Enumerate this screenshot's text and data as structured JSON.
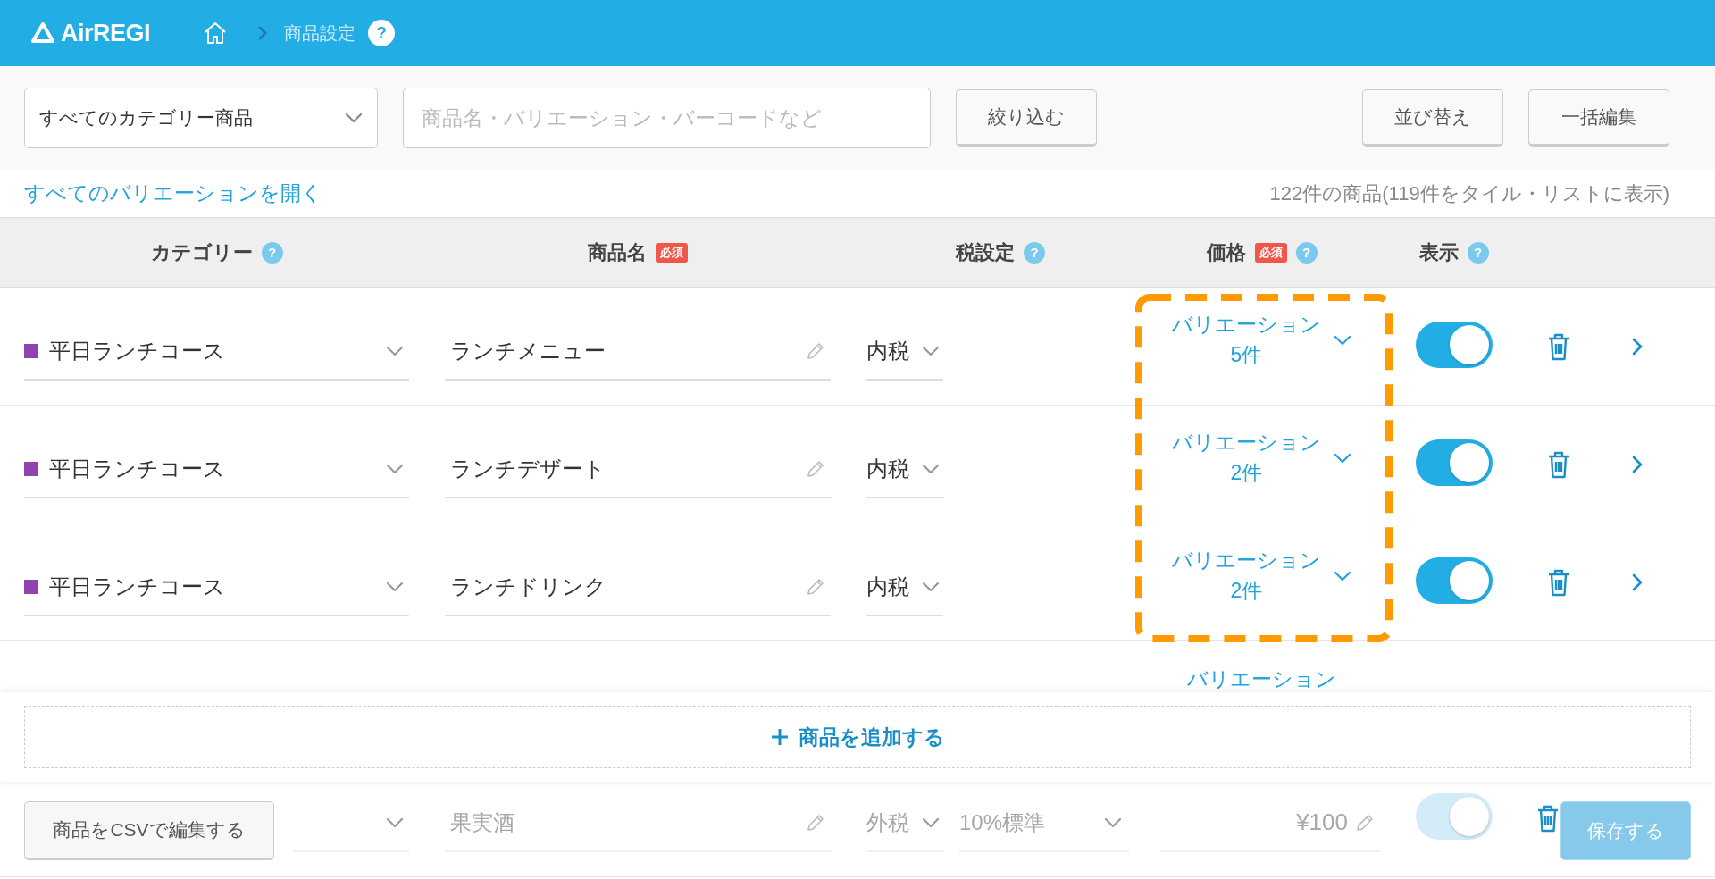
{
  "header": {
    "logo": "AirREGI",
    "breadcrumb": "商品設定",
    "help": "?"
  },
  "toolbar": {
    "category_select": "すべてのカテゴリー商品",
    "search": {
      "placeholder": "商品名・バリエーション・バーコードなど"
    },
    "filter_button": "絞り込む",
    "sort_button": "並び替え",
    "bulk_edit_button": "一括編集"
  },
  "expand_link": "すべてのバリエーションを開く",
  "count": "122件の商品(119件をタイル・リストに表示)",
  "table": {
    "columns": [
      {
        "label": "カテゴリー",
        "help": "?"
      },
      {
        "label": "商品名",
        "badge": "必須"
      },
      {
        "label": "税設定",
        "help": "?"
      },
      {
        "label": "価格",
        "badge": "必須",
        "help": "?"
      },
      {
        "label": "表示",
        "help": "?"
      }
    ],
    "rows": [
      {
        "kind": "variations",
        "category": "平日ランチコース",
        "color": "#8e44b0",
        "name": "ランチメニュー",
        "tax": "内税",
        "variation_label": "バリエーション",
        "variation_count": "5件",
        "visible": true
      },
      {
        "kind": "variations",
        "category": "平日ランチコース",
        "color": "#8e44b0",
        "name": "ランチデザート",
        "tax": "内税",
        "variation_label": "バリエーション",
        "variation_count": "2件",
        "visible": true
      },
      {
        "kind": "variations",
        "category": "平日ランチコース",
        "color": "#8e44b0",
        "name": "ランチドリンク",
        "tax": "内税",
        "variation_label": "バリエーション",
        "variation_count": "2件",
        "visible": true
      },
      {
        "kind": "variations",
        "variation_label": "バリエーション"
      },
      {
        "kind": "price",
        "name": "果実酒",
        "tax": "外税",
        "tax_rate": "10%標準",
        "price": "¥100",
        "visible": true
      }
    ]
  },
  "add_button": {
    "label": "商品を追加する"
  },
  "footer": {
    "csv_button": "商品をCSVで編集する",
    "save_button": {
      "label": "保存する",
      "disabled": true
    }
  }
}
